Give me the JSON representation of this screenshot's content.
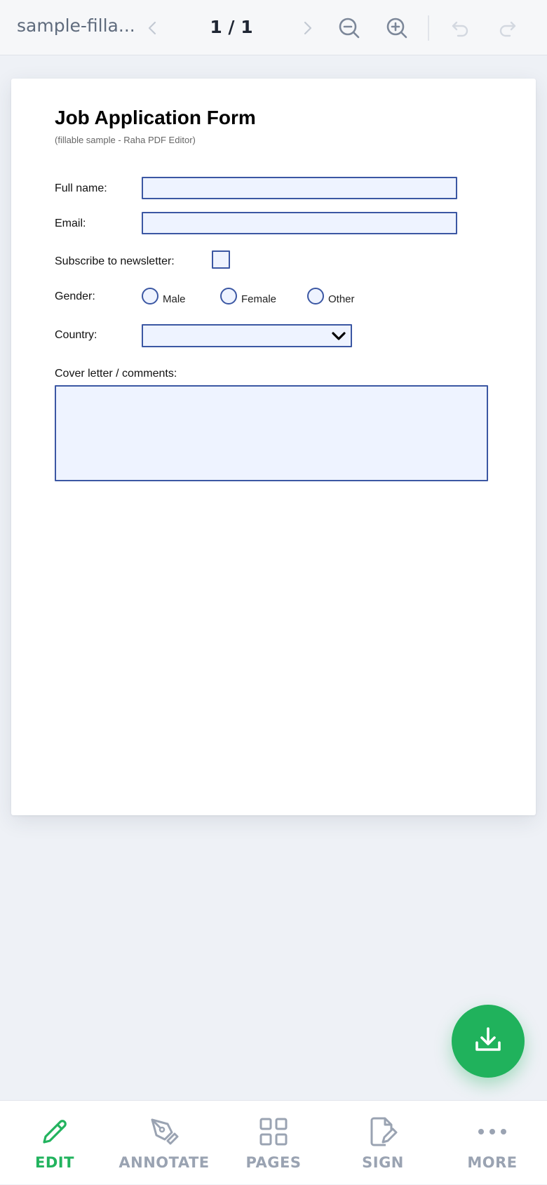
{
  "toolbar": {
    "doc_title": "sample-filla...",
    "page_counter": "1 / 1",
    "icons": [
      "chevron-left-icon",
      "chevron-right-icon",
      "zoom-out-icon",
      "zoom-in-icon",
      "undo-icon",
      "redo-icon"
    ]
  },
  "form": {
    "title": "Job Application Form",
    "subtitle": "(fillable sample - Raha PDF Editor)",
    "full_name_label": "Full name:",
    "full_name_value": "",
    "email_label": "Email:",
    "email_value": "",
    "newsletter_label": "Subscribe to newsletter:",
    "newsletter_checked": false,
    "gender_label": "Gender:",
    "gender_options": [
      "Male",
      "Female",
      "Other"
    ],
    "country_label": "Country:",
    "country_value": "",
    "comments_label": "Cover letter / comments:",
    "comments_value": ""
  },
  "fab": {
    "icon": "download-icon"
  },
  "bottom_nav": {
    "items": [
      {
        "label": "EDIT",
        "icon": "pencil-icon",
        "active": true
      },
      {
        "label": "ANNOTATE",
        "icon": "pen-nib-icon",
        "active": false
      },
      {
        "label": "PAGES",
        "icon": "grid-icon",
        "active": false
      },
      {
        "label": "SIGN",
        "icon": "sign-document-icon",
        "active": false
      },
      {
        "label": "MORE",
        "icon": "more-dots-icon",
        "active": false
      }
    ]
  },
  "colors": {
    "accent_green": "#20b25c",
    "field_border": "#3b57a3",
    "field_fill": "#eef3ff",
    "inactive_gray": "#9aa3b2"
  }
}
